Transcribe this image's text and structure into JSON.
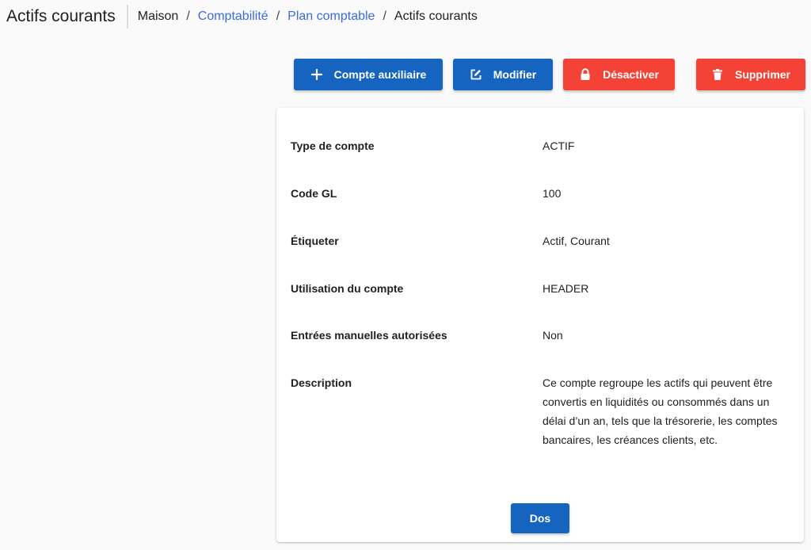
{
  "header": {
    "title": "Actifs courants",
    "breadcrumb": [
      {
        "label": "Maison",
        "link": false
      },
      {
        "label": "Comptabilité",
        "link": true
      },
      {
        "label": "Plan comptable",
        "link": true
      },
      {
        "label": "Actifs courants",
        "link": false
      }
    ],
    "separator": "/"
  },
  "toolbar": {
    "add_sub_label": "Compte auxiliaire",
    "add_sub_icon": "plus-icon",
    "edit_label": "Modifier",
    "edit_icon": "edit-icon",
    "disable_label": "Désactiver",
    "disable_icon": "lock-icon",
    "delete_label": "Supprimer",
    "delete_icon": "trash-icon"
  },
  "details": {
    "account_type": {
      "label": "Type de compte",
      "value": "ACTIF"
    },
    "gl_code": {
      "label": "Code GL",
      "value": "100"
    },
    "tags": {
      "label": "Étiqueter",
      "value": "Actif, Courant"
    },
    "usage": {
      "label": "Utilisation du compte",
      "value": "HEADER"
    },
    "manual_entries": {
      "label": "Entrées manuelles autorisées",
      "value": "Non"
    },
    "description": {
      "label": "Description",
      "value": "Ce compte regroupe les actifs qui peuvent être convertis en liquidités ou consommés dans un délai d’un an, tels que la trésorerie, les comptes bancaires, les créances clients, etc."
    }
  },
  "footer": {
    "back_label": "Dos"
  },
  "colors": {
    "primary": "#1565c0",
    "danger": "#f44336",
    "link": "#3d6bde",
    "background": "#fafafa"
  }
}
